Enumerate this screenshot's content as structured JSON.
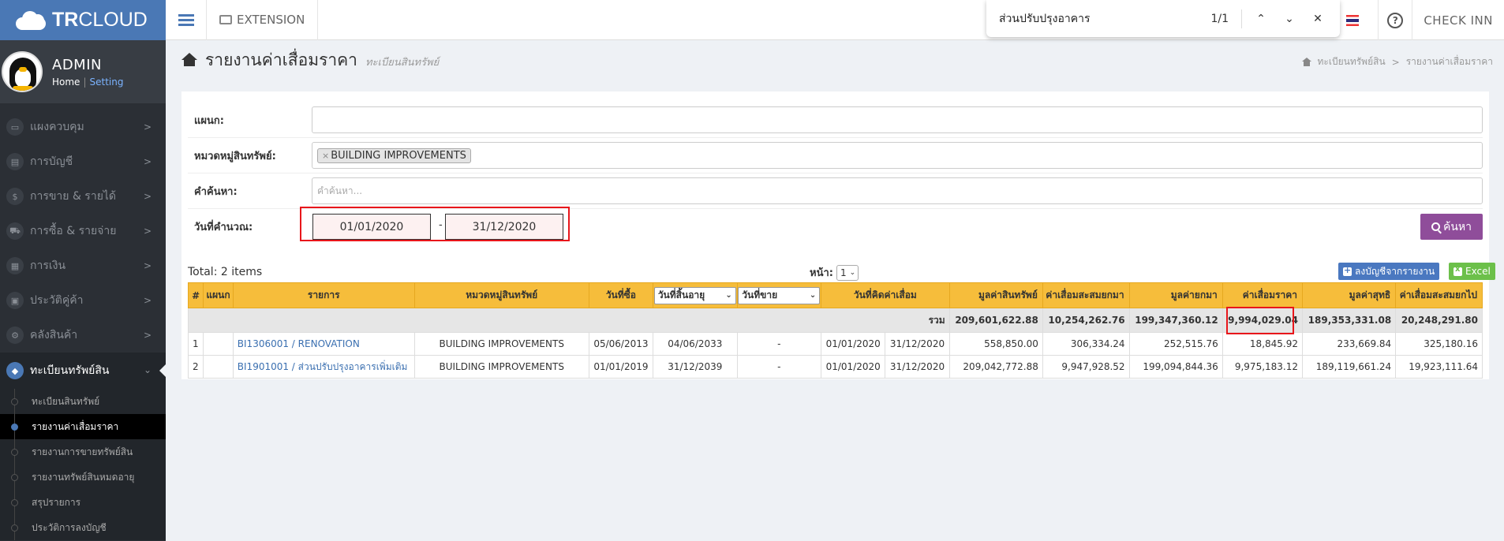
{
  "brand": {
    "name_bold": "TR",
    "name_rest": "CLOUD"
  },
  "user": {
    "name": "ADMIN",
    "home": "Home",
    "sep": "|",
    "setting": "Setting"
  },
  "sidebar": {
    "items": [
      {
        "label": "แผงควบคุม",
        "icon": "▭"
      },
      {
        "label": "การบัญชี",
        "icon": "▤"
      },
      {
        "label": "การขาย & รายได้",
        "icon": "$"
      },
      {
        "label": "การซื้อ & รายจ่าย",
        "icon": "⛟"
      },
      {
        "label": "การเงิน",
        "icon": "▦"
      },
      {
        "label": "ประวัติคู่ค้า",
        "icon": "▣"
      },
      {
        "label": "คลังสินค้า",
        "icon": "⚙"
      }
    ],
    "active": {
      "label": "ทะเบียนทรัพย์สิน",
      "icon": "◆"
    },
    "sub_items": [
      {
        "label": "ทะเบียนสินทรัพย์"
      },
      {
        "label": "รายงานค่าเสื่อมราคา"
      },
      {
        "label": "รายงานการขายทรัพย์สิน"
      },
      {
        "label": "รายงานทรัพย์สินหมดอายุ"
      },
      {
        "label": "สรุปรายการ"
      },
      {
        "label": "ประวัติการลงบัญชี"
      }
    ]
  },
  "topbar": {
    "extension": "EXTENSION",
    "help": "?",
    "company": "CHECK INN"
  },
  "findbar": {
    "query": "ส่วนปรับปรุงอาคาร",
    "count": "1/1",
    "up": "⌃",
    "down": "⌄",
    "close": "✕"
  },
  "page": {
    "title": "รายงานค่าเสื่อมราคา",
    "subtitle": "ทะเบียนสินทรัพย์",
    "breadcrumb": [
      "ทะเบียนทรัพย์สิน",
      "รายงานค่าเสื่อมราคา"
    ],
    "crumb_sep": ">"
  },
  "filters": {
    "dept_label": "แผนก:",
    "category_label": "หมวดหมู่สินทรัพย์:",
    "category_tag": "BUILDING IMPROVEMENTS",
    "tag_remove": "×",
    "search_label": "คำค้นหา:",
    "search_placeholder": "คำค้นหา...",
    "date_label": "วันที่คำนวณ:",
    "date_from": "01/01/2020",
    "date_sep": "-",
    "date_to": "31/12/2020",
    "search_button": "ค้นหา"
  },
  "table_meta": {
    "total": "Total: 2 items",
    "page_label": "หน้า:",
    "page_value": "1",
    "post_button": "ลงบัญชีจากรายงาน",
    "excel_button": "Excel"
  },
  "table": {
    "headers": [
      "#",
      "แผนก",
      "รายการ",
      "หมวดหมู่สินทรัพย์",
      "วันที่ซื้อ",
      "วันที่สิ้นอายุ",
      "วันที่ขาย",
      "วันที่คิดค่าเสื่อม",
      "มูลค่าสินทรัพย์",
      "ค่าเสื่อมสะสมยกมา",
      "มูลค่ายกมา",
      "ค่าเสื่อมราคา",
      "มูลค่าสุทธิ",
      "ค่าเสื่อมสะสมยกไป"
    ],
    "summary": {
      "label": "รวม",
      "asset_value": "209,601,622.88",
      "accum_bf": "10,254,262.76",
      "value_bf": "199,347,360.12",
      "depreciation": "9,994,029.04",
      "net_value": "189,353,331.08",
      "accum_cf": "20,248,291.80"
    },
    "rows": [
      {
        "no": "1",
        "dept": "",
        "item": "BI1306001 / RENOVATION",
        "category": "BUILDING IMPROVEMENTS",
        "purchase": "05/06/2013",
        "expire": "04/06/2033",
        "sold": "-",
        "calc_from": "01/01/2020",
        "calc_to": "31/12/2020",
        "asset_value": "558,850.00",
        "accum_bf": "306,334.24",
        "value_bf": "252,515.76",
        "depreciation": "18,845.92",
        "net_value": "233,669.84",
        "accum_cf": "325,180.16"
      },
      {
        "no": "2",
        "dept": "",
        "item": "BI1901001 / ส่วนปรับปรุงอาคารเพิ่มเติม",
        "category": "BUILDING IMPROVEMENTS",
        "purchase": "01/01/2019",
        "expire": "31/12/2039",
        "sold": "-",
        "calc_from": "01/01/2020",
        "calc_to": "31/12/2020",
        "asset_value": "209,042,772.88",
        "accum_bf": "9,947,928.52",
        "value_bf": "199,094,844.36",
        "depreciation": "9,975,183.12",
        "net_value": "189,119,661.24",
        "accum_cf": "19,923,111.64"
      }
    ]
  }
}
